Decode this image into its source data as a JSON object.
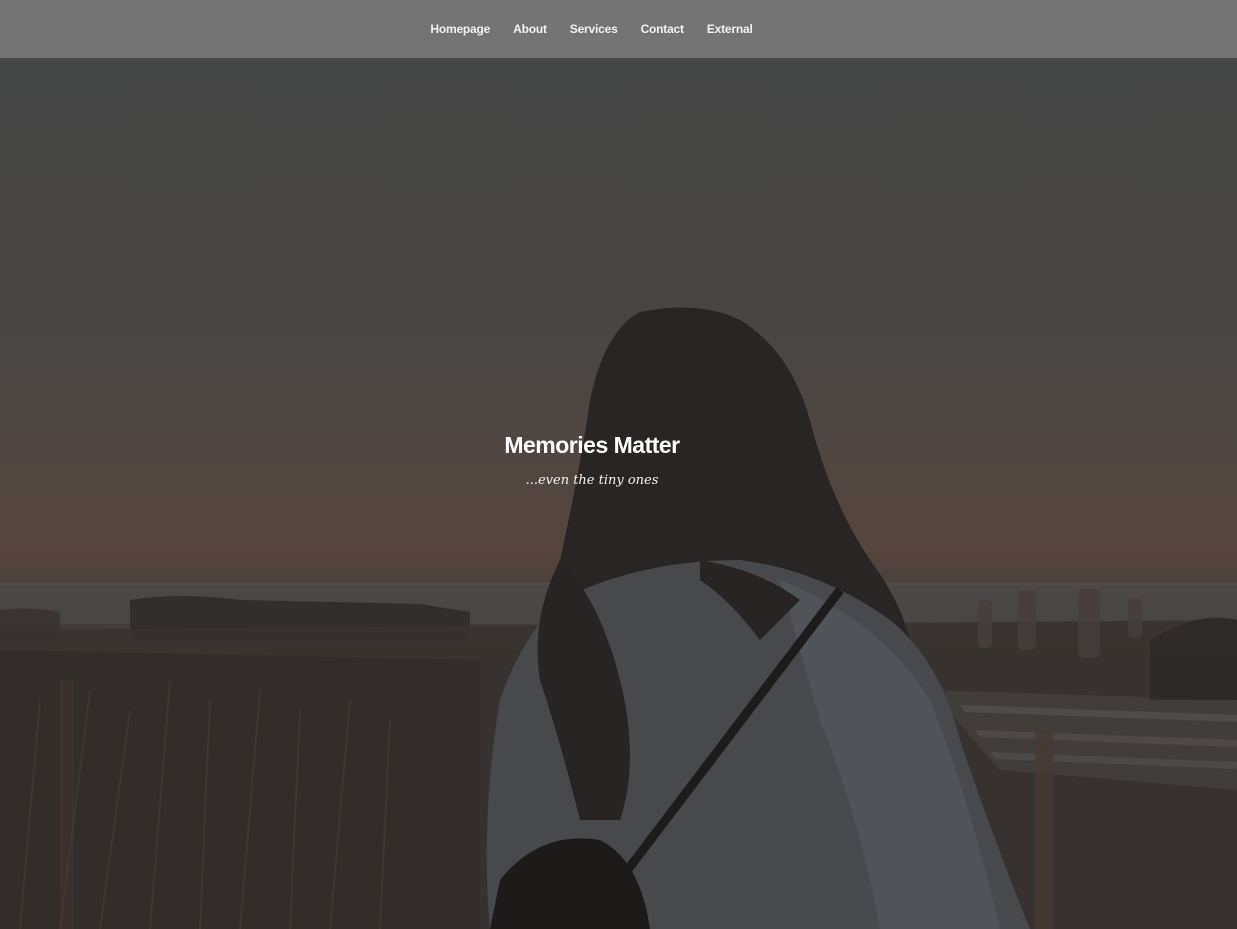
{
  "nav": {
    "items": [
      {
        "label": "Homepage"
      },
      {
        "label": "About"
      },
      {
        "label": "Services"
      },
      {
        "label": "Contact"
      },
      {
        "label": "External"
      }
    ]
  },
  "hero": {
    "title": "Memories Matter",
    "subtitle": "...even the tiny ones",
    "image_icon": "hero-background-photo"
  },
  "colors": {
    "navbar_bg": "#747474",
    "nav_text": "#f1f1f1",
    "hero_text": "#ffffff"
  }
}
